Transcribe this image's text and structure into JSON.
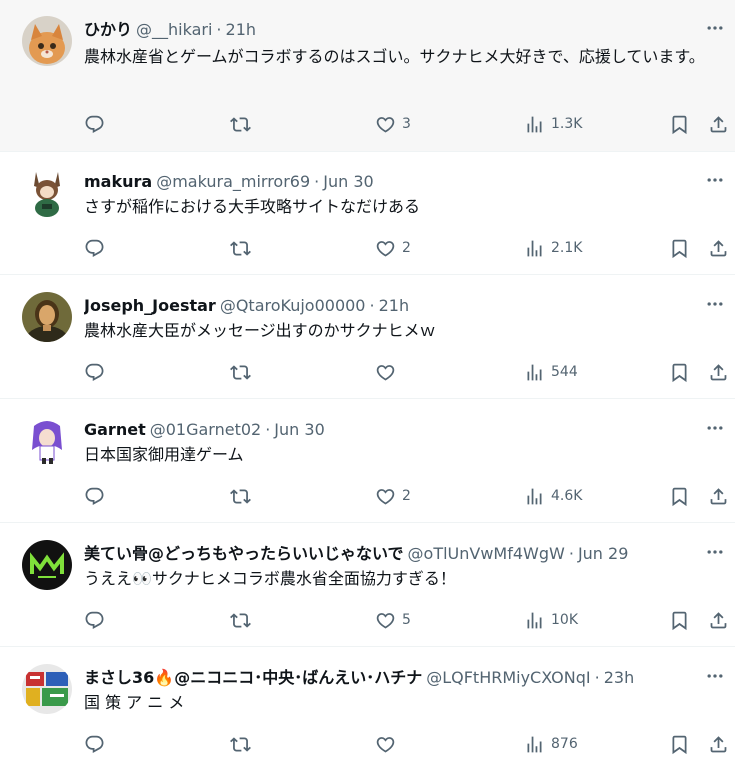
{
  "tweets": [
    {
      "name": "ひかり",
      "handle": "@__hikari",
      "time": "21h",
      "text": "農林水産省とゲームがコラボするのはスゴい。サクナヒメ大好きで、応援しています。",
      "likes": "3",
      "views": "1.3K",
      "avatar": "cat-photo"
    },
    {
      "name": "makura",
      "handle": "@makura_mirror69",
      "time": "Jun 30",
      "text": "さすが稲作における大手攻略サイトなだけある",
      "likes": "2",
      "views": "2.1K",
      "avatar": "anime-character-green"
    },
    {
      "name": "Joseph_Joestar",
      "handle": "@QtaroKujo00000",
      "time": "21h",
      "text": "農林水産大臣がメッセージ出すのかサクナヒメｗ",
      "likes": "",
      "views": "544",
      "avatar": "mona-lisa"
    },
    {
      "name": "Garnet",
      "handle": "@01Garnet02",
      "time": "Jun 30",
      "text": "日本国家御用達ゲーム",
      "likes": "2",
      "views": "4.6K",
      "avatar": "anime-character-purple"
    },
    {
      "name": "美てい骨@どっちもやったらいいじゃないで",
      "handle": "@oTlUnVwMf4WgW",
      "time": "Jun 29",
      "text": "うええ👀サクナヒメコラボ農水省全面協力すぎる！",
      "likes": "5",
      "views": "10K",
      "avatar": "dark-logo-green"
    },
    {
      "name": "まさし36🔥@ニコニコ･中央･ばんえい･ハチナ",
      "handle": "@LQFtHRMiyCXONqI",
      "time": "23h",
      "text": "国 策 ア ニ メ",
      "likes": "",
      "views": "876",
      "avatar": "colorful-collage"
    }
  ],
  "colors": {
    "secondary_text": "#536471",
    "primary_text": "#0f1419",
    "highlight_bg": "#f7f7f7",
    "divider": "#eff3f4"
  }
}
